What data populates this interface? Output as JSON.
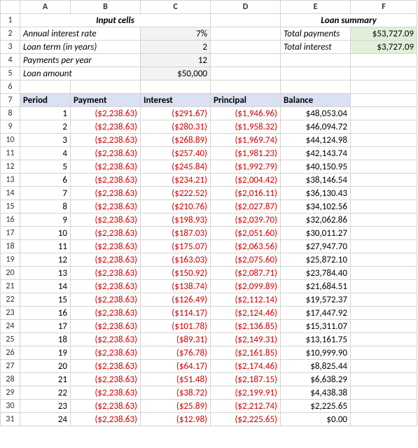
{
  "cols": [
    "A",
    "B",
    "C",
    "D",
    "E",
    "F"
  ],
  "input_title": "Input cells",
  "summary_title": "Loan summary",
  "labels": {
    "annual_rate": "Annual interest rate",
    "loan_term": "Loan term (in years)",
    "payments_per_year": "Payments per year",
    "loan_amount": "Loan amount",
    "total_payments": "Total payments",
    "total_interest": "Total interest"
  },
  "inputs": {
    "annual_rate": "7%",
    "loan_term": "2",
    "payments_per_year": "12",
    "loan_amount": "$50,000"
  },
  "summary": {
    "total_payments": "$53,727.09",
    "total_interest": "$3,727.09"
  },
  "headers": {
    "period": "Period",
    "payment": "Payment",
    "interest": "Interest",
    "principal": "Principal",
    "balance": "Balance"
  },
  "rows": [
    {
      "r": "8",
      "period": "1",
      "payment": "($2,238.63)",
      "interest": "($291.67)",
      "principal": "($1,946.96)",
      "balance": "$48,053.04"
    },
    {
      "r": "9",
      "period": "2",
      "payment": "($2,238.63)",
      "interest": "($280.31)",
      "principal": "($1,958.32)",
      "balance": "$46,094.72"
    },
    {
      "r": "10",
      "period": "3",
      "payment": "($2,238.63)",
      "interest": "($268.89)",
      "principal": "($1,969.74)",
      "balance": "$44,124.98"
    },
    {
      "r": "11",
      "period": "4",
      "payment": "($2,238.63)",
      "interest": "($257.40)",
      "principal": "($1,981.23)",
      "balance": "$42,143.74"
    },
    {
      "r": "12",
      "period": "5",
      "payment": "($2,238.63)",
      "interest": "($245.84)",
      "principal": "($1,992.79)",
      "balance": "$40,150.95"
    },
    {
      "r": "13",
      "period": "6",
      "payment": "($2,238.63)",
      "interest": "($234.21)",
      "principal": "($2,004.42)",
      "balance": "$38,146.54"
    },
    {
      "r": "14",
      "period": "7",
      "payment": "($2,238.63)",
      "interest": "($222.52)",
      "principal": "($2,016.11)",
      "balance": "$36,130.43"
    },
    {
      "r": "15",
      "period": "8",
      "payment": "($2,238.63)",
      "interest": "($210.76)",
      "principal": "($2,027.87)",
      "balance": "$34,102.56"
    },
    {
      "r": "16",
      "period": "9",
      "payment": "($2,238.63)",
      "interest": "($198.93)",
      "principal": "($2,039.70)",
      "balance": "$32,062.86"
    },
    {
      "r": "17",
      "period": "10",
      "payment": "($2,238.63)",
      "interest": "($187.03)",
      "principal": "($2,051.60)",
      "balance": "$30,011.27"
    },
    {
      "r": "18",
      "period": "11",
      "payment": "($2,238.63)",
      "interest": "($175.07)",
      "principal": "($2,063.56)",
      "balance": "$27,947.70"
    },
    {
      "r": "19",
      "period": "12",
      "payment": "($2,238.63)",
      "interest": "($163.03)",
      "principal": "($2,075.60)",
      "balance": "$25,872.10"
    },
    {
      "r": "20",
      "period": "13",
      "payment": "($2,238.63)",
      "interest": "($150.92)",
      "principal": "($2,087.71)",
      "balance": "$23,784.40"
    },
    {
      "r": "21",
      "period": "14",
      "payment": "($2,238.63)",
      "interest": "($138.74)",
      "principal": "($2,099.89)",
      "balance": "$21,684.51"
    },
    {
      "r": "22",
      "period": "15",
      "payment": "($2,238.63)",
      "interest": "($126.49)",
      "principal": "($2,112.14)",
      "balance": "$19,572.37"
    },
    {
      "r": "23",
      "period": "16",
      "payment": "($2,238.63)",
      "interest": "($114.17)",
      "principal": "($2,124.46)",
      "balance": "$17,447.92"
    },
    {
      "r": "24",
      "period": "17",
      "payment": "($2,238.63)",
      "interest": "($101.78)",
      "principal": "($2,136.85)",
      "balance": "$15,311.07"
    },
    {
      "r": "25",
      "period": "18",
      "payment": "($2,238.63)",
      "interest": "($89.31)",
      "principal": "($2,149.31)",
      "balance": "$13,161.75"
    },
    {
      "r": "26",
      "period": "19",
      "payment": "($2,238.63)",
      "interest": "($76.78)",
      "principal": "($2,161.85)",
      "balance": "$10,999.90"
    },
    {
      "r": "27",
      "period": "20",
      "payment": "($2,238.63)",
      "interest": "($64.17)",
      "principal": "($2,174.46)",
      "balance": "$8,825.44"
    },
    {
      "r": "28",
      "period": "21",
      "payment": "($2,238.63)",
      "interest": "($51.48)",
      "principal": "($2,187.15)",
      "balance": "$6,638.29"
    },
    {
      "r": "29",
      "period": "22",
      "payment": "($2,238.63)",
      "interest": "($38.72)",
      "principal": "($2,199.91)",
      "balance": "$4,438.38"
    },
    {
      "r": "30",
      "period": "23",
      "payment": "($2,238.63)",
      "interest": "($25.89)",
      "principal": "($2,212.74)",
      "balance": "$2,225.65"
    },
    {
      "r": "31",
      "period": "24",
      "payment": "($2,238.63)",
      "interest": "($12.98)",
      "principal": "($2,225.65)",
      "balance": "$0.00"
    }
  ],
  "chart_data": {
    "type": "table",
    "title": "Loan amortization schedule",
    "inputs": {
      "annual_interest_rate": 0.07,
      "loan_term_years": 2,
      "payments_per_year": 12,
      "loan_amount": 50000
    },
    "summary": {
      "total_payments": 53727.09,
      "total_interest": 3727.09
    },
    "columns": [
      "Period",
      "Payment",
      "Interest",
      "Principal",
      "Balance"
    ],
    "data": [
      [
        1,
        -2238.63,
        -291.67,
        -1946.96,
        48053.04
      ],
      [
        2,
        -2238.63,
        -280.31,
        -1958.32,
        46094.72
      ],
      [
        3,
        -2238.63,
        -268.89,
        -1969.74,
        44124.98
      ],
      [
        4,
        -2238.63,
        -257.4,
        -1981.23,
        42143.74
      ],
      [
        5,
        -2238.63,
        -245.84,
        -1992.79,
        40150.95
      ],
      [
        6,
        -2238.63,
        -234.21,
        -2004.42,
        38146.54
      ],
      [
        7,
        -2238.63,
        -222.52,
        -2016.11,
        36130.43
      ],
      [
        8,
        -2238.63,
        -210.76,
        -2027.87,
        34102.56
      ],
      [
        9,
        -2238.63,
        -198.93,
        -2039.7,
        32062.86
      ],
      [
        10,
        -2238.63,
        -187.03,
        -2051.6,
        30011.27
      ],
      [
        11,
        -2238.63,
        -175.07,
        -2063.56,
        27947.7
      ],
      [
        12,
        -2238.63,
        -163.03,
        -2075.6,
        25872.1
      ],
      [
        13,
        -2238.63,
        -150.92,
        -2087.71,
        23784.4
      ],
      [
        14,
        -2238.63,
        -138.74,
        -2099.89,
        21684.51
      ],
      [
        15,
        -2238.63,
        -126.49,
        -2112.14,
        19572.37
      ],
      [
        16,
        -2238.63,
        -114.17,
        -2124.46,
        17447.92
      ],
      [
        17,
        -2238.63,
        -101.78,
        -2136.85,
        15311.07
      ],
      [
        18,
        -2238.63,
        -89.31,
        -2149.31,
        13161.75
      ],
      [
        19,
        -2238.63,
        -76.78,
        -2161.85,
        10999.9
      ],
      [
        20,
        -2238.63,
        -64.17,
        -2174.46,
        8825.44
      ],
      [
        21,
        -2238.63,
        -51.48,
        -2187.15,
        6638.29
      ],
      [
        22,
        -2238.63,
        -38.72,
        -2199.91,
        4438.38
      ],
      [
        23,
        -2238.63,
        -25.89,
        -2212.74,
        2225.65
      ],
      [
        24,
        -2238.63,
        -12.98,
        -2225.65,
        0.0
      ]
    ]
  }
}
